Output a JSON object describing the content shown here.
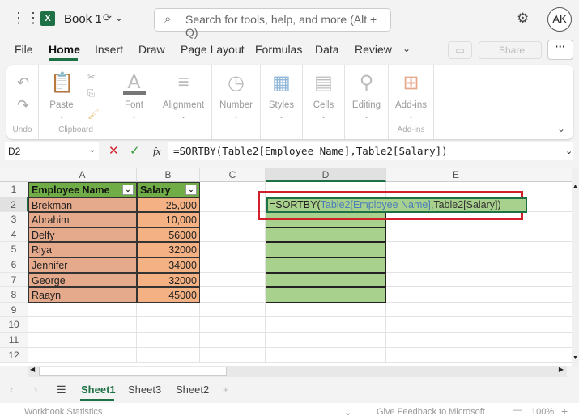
{
  "titlebar": {
    "app_icon": "excel-icon",
    "book": "Book 1",
    "search_placeholder": "Search for tools, help, and more (Alt + Q)",
    "avatar": "AK"
  },
  "menu": [
    "File",
    "Home",
    "Insert",
    "Draw",
    "Page Layout",
    "Formulas",
    "Data",
    "Review"
  ],
  "menu_active": "Home",
  "share_label": "Share",
  "ribbon": {
    "undo_group": "Undo",
    "paste": "Paste",
    "clipboard": "Clipboard",
    "font": "Font",
    "alignment": "Alignment",
    "number": "Number",
    "styles": "Styles",
    "cells": "Cells",
    "editing": "Editing",
    "addins": "Add-ins",
    "addins_group": "Add-ins"
  },
  "formula_bar": {
    "name_box": "D2",
    "fx": "fx",
    "formula": "=SORTBY(Table2[Employee Name],Table2[Salary])"
  },
  "columns": [
    "A",
    "B",
    "C",
    "D",
    "E"
  ],
  "rows": [
    "1",
    "2",
    "3",
    "4",
    "5",
    "6",
    "7",
    "8",
    "9",
    "10",
    "11",
    "12"
  ],
  "table": {
    "headers": [
      "Employee Name",
      "Salary"
    ],
    "rows": [
      [
        "Brekman",
        "25,000"
      ],
      [
        "Abrahim",
        "10,000"
      ],
      [
        "Delfy",
        "56000"
      ],
      [
        "Riya",
        "32000"
      ],
      [
        "Jennifer",
        "34000"
      ],
      [
        "George",
        "32000"
      ],
      [
        "Raayn",
        "45000"
      ]
    ]
  },
  "edit_cell": {
    "prefix": "=SORTBY(",
    "ref1": "Table2[Employee Name]",
    "sep": ",",
    "ref2": "Table2[Salary]",
    "suffix": ")"
  },
  "sheets": [
    "Sheet1",
    "Sheet3",
    "Sheet2"
  ],
  "active_sheet": "Sheet1",
  "status": {
    "left": "Workbook Statistics",
    "feedback": "Give Feedback to Microsoft",
    "zoom": "100%"
  }
}
